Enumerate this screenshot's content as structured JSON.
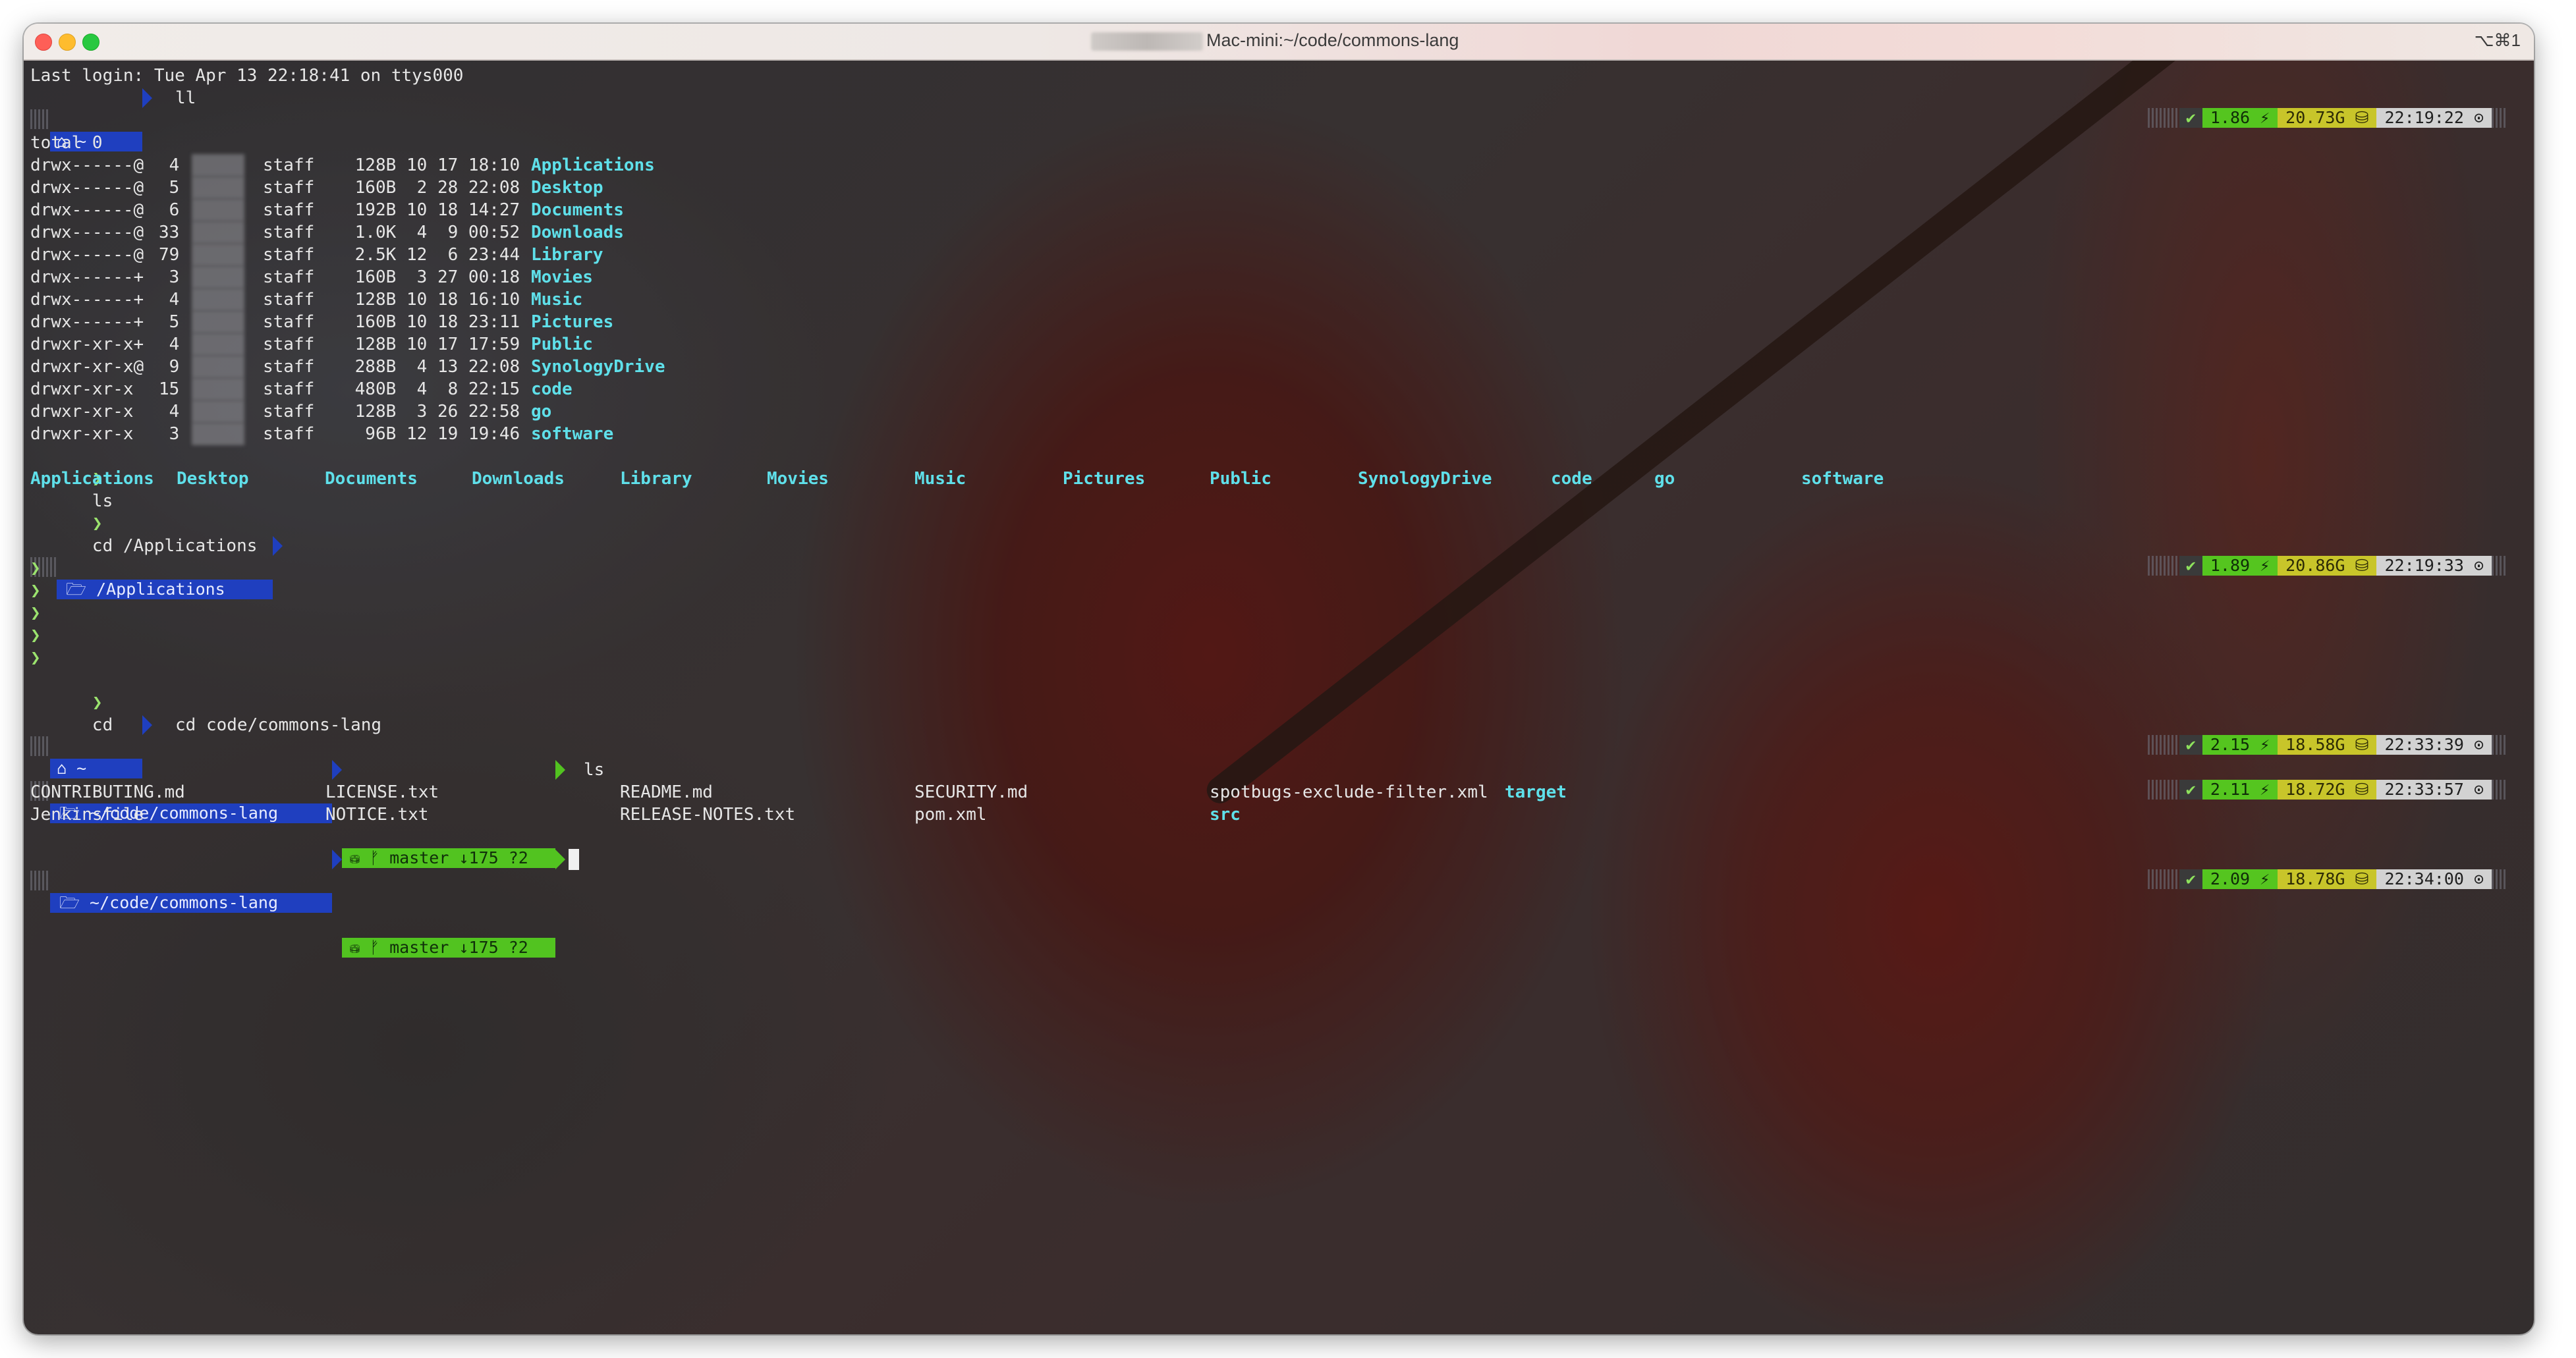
{
  "window": {
    "title": "Mac-mini:~/code/commons-lang",
    "shortcut": "⌥⌘1"
  },
  "terminal": {
    "last_login": "Last login: Tue Apr 13 22:18:41 on ttys000",
    "home_prompt_label": "⌂ ~",
    "cmd_ll": "ll",
    "total": "total 0",
    "ll_rows": [
      {
        "perm": "drwx------@",
        "links": " 4",
        "group": "staff",
        "size": " 128B",
        "date": "10 17 18:10",
        "name": "Applications"
      },
      {
        "perm": "drwx------@",
        "links": " 5",
        "group": "staff",
        "size": " 160B",
        "date": " 2 28 22:08",
        "name": "Desktop"
      },
      {
        "perm": "drwx------@",
        "links": " 6",
        "group": "staff",
        "size": " 192B",
        "date": "10 18 14:27",
        "name": "Documents"
      },
      {
        "perm": "drwx------@",
        "links": "33",
        "group": "staff",
        "size": " 1.0K",
        "date": " 4  9 00:52",
        "name": "Downloads"
      },
      {
        "perm": "drwx------@",
        "links": "79",
        "group": "staff",
        "size": " 2.5K",
        "date": "12  6 23:44",
        "name": "Library"
      },
      {
        "perm": "drwx------+",
        "links": " 3",
        "group": "staff",
        "size": " 160B",
        "date": " 3 27 00:18",
        "name": "Movies"
      },
      {
        "perm": "drwx------+",
        "links": " 4",
        "group": "staff",
        "size": " 128B",
        "date": "10 18 16:10",
        "name": "Music"
      },
      {
        "perm": "drwx------+",
        "links": " 5",
        "group": "staff",
        "size": " 160B",
        "date": "10 18 23:11",
        "name": "Pictures"
      },
      {
        "perm": "drwxr-xr-x+",
        "links": " 4",
        "group": "staff",
        "size": " 128B",
        "date": "10 17 17:59",
        "name": "Public"
      },
      {
        "perm": "drwxr-xr-x@",
        "links": " 9",
        "group": "staff",
        "size": " 288B",
        "date": " 4 13 22:08",
        "name": "SynologyDrive"
      },
      {
        "perm": "drwxr-xr-x ",
        "links": "15",
        "group": "staff",
        "size": " 480B",
        "date": " 4  8 22:15",
        "name": "code"
      },
      {
        "perm": "drwxr-xr-x ",
        "links": " 4",
        "group": "staff",
        "size": " 128B",
        "date": " 3 26 22:58",
        "name": "go"
      },
      {
        "perm": "drwxr-xr-x ",
        "links": " 3",
        "group": "staff",
        "size": "  96B",
        "date": "12 19 19:46",
        "name": "software"
      }
    ],
    "cmd_ls": "ls",
    "ls_home": [
      "Applications",
      "Desktop",
      "Documents",
      "Downloads",
      "Library",
      "Movies",
      "Music",
      "Pictures",
      "Public",
      "SynologyDrive",
      "code",
      "go",
      "software"
    ],
    "cmd_cd_apps": "cd /Applications",
    "apps_prompt_label": "🗁 /Applications",
    "prompt_char": "❯",
    "cmd_cd": "cd",
    "cmd_cd_commons": "cd code/commons-lang",
    "repo_prompt_label": "🗁 ~/code/commons-lang",
    "git_label": "⛁ ᚠ master ↓175 ?2",
    "cmd_ls2": "ls",
    "repo_files_row1": [
      "CONTRIBUTING.md",
      "LICENSE.txt",
      "README.md",
      "SECURITY.md",
      "spotbugs-exclude-filter.xml",
      "target"
    ],
    "repo_files_row2": [
      "Jenkinsfile",
      "NOTICE.txt",
      "RELEASE-NOTES.txt",
      "pom.xml",
      "src"
    ]
  },
  "right_prompts": [
    {
      "ok": "✔",
      "load": "1.86 ⚡",
      "mem": "20.73G ⛁",
      "time": "22:19:22 ⊙"
    },
    {
      "ok": "✔",
      "load": "1.89 ⚡",
      "mem": "20.86G ⛁",
      "time": "22:19:33 ⊙"
    },
    {
      "ok": "✔",
      "load": "2.15 ⚡",
      "mem": "18.58G ⛁",
      "time": "22:33:39 ⊙"
    },
    {
      "ok": "✔",
      "load": "2.11 ⚡",
      "mem": "18.72G ⛁",
      "time": "22:33:57 ⊙"
    },
    {
      "ok": "✔",
      "load": "2.09 ⚡",
      "mem": "18.78G ⛁",
      "time": "22:34:00 ⊙"
    }
  ],
  "colors": {
    "dir": "#5fe0ea",
    "prompt_blue": "#1f3fbf",
    "git_green": "#52c320",
    "mem_yellow": "#c8c52a"
  }
}
